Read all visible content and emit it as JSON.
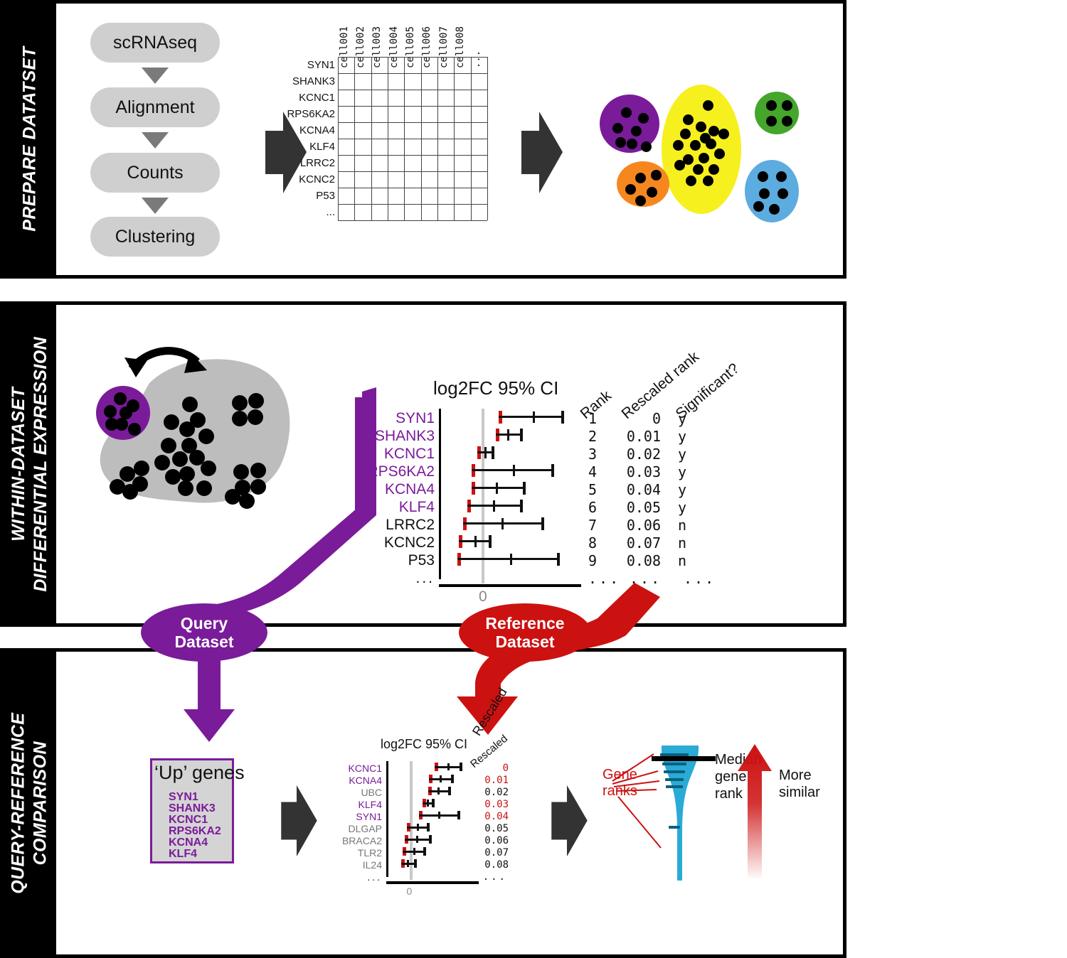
{
  "figure": {
    "title": "scRNAseq query-reference comparison workflow",
    "colors": {
      "purple": "#7a1b9a",
      "red": "#cc1111",
      "yellow": "#f6f01e",
      "green": "#44a62b",
      "orange": "#f6871f",
      "blue": "#5cacdf",
      "cyan": "#29abd6",
      "gray_blob": "#bdbdbd",
      "dark_arrow": "#333333",
      "flow_box": "#cfcfcf"
    }
  },
  "panel1": {
    "side_label_lines": [
      "PREPARE DATATSET"
    ],
    "flow_steps": [
      {
        "label": "scRNAseq"
      },
      {
        "label": "Alignment"
      },
      {
        "label": "Counts"
      },
      {
        "label": "Clustering"
      }
    ],
    "matrix": {
      "row_labels": [
        "SYN1",
        "SHANK3",
        "KCNC1",
        "RPS6KA2",
        "KCNA4",
        "KLF4",
        "LRRC2",
        "KCNC2",
        "P53",
        "..."
      ],
      "col_labels": [
        "cell001",
        "cell002",
        "cell003",
        "cell004",
        "cell005",
        "cell006",
        "cell007",
        "cell008",
        "..."
      ]
    },
    "clusters": [
      {
        "name": "purple-cluster",
        "color": "#7a1b9a",
        "cells": 7
      },
      {
        "name": "yellow-cluster",
        "color": "#f6f01e",
        "cells": 18
      },
      {
        "name": "green-cluster",
        "color": "#44a62b",
        "cells": 4
      },
      {
        "name": "orange-cluster",
        "color": "#f6871f",
        "cells": 5
      },
      {
        "name": "blue-cluster",
        "color": "#5cacdf",
        "cells": 6
      }
    ]
  },
  "panel2": {
    "side_label_lines": [
      "WITHIN-DATASET",
      "DIFFERENTIAL EXPRESSION"
    ],
    "cluster_compare": {
      "query_cluster_color": "#7a1b9a",
      "background_color": "#bdbdbd",
      "arrow": "double-headed-curved-arrow"
    },
    "forest": {
      "plot_title": "log2FC 95% CI",
      "zero_label": "0",
      "headers": [
        "Rank",
        "Rescaled rank",
        "Significant?"
      ],
      "ellipsis": "...",
      "rows": [
        {
          "gene": "SYN1",
          "highlight": true,
          "rank": "1",
          "rescaled": "0",
          "significant": "y",
          "lo": 0.42,
          "mid": 0.66,
          "hi": 0.86
        },
        {
          "gene": "SHANK3",
          "highlight": true,
          "rank": "2",
          "rescaled": "0.01",
          "significant": "y",
          "lo": 0.4,
          "mid": 0.48,
          "hi": 0.57
        },
        {
          "gene": "KCNC1",
          "highlight": true,
          "rank": "3",
          "rescaled": "0.02",
          "significant": "y",
          "lo": 0.27,
          "mid": 0.32,
          "hi": 0.37
        },
        {
          "gene": "RPS6KA2",
          "highlight": true,
          "rank": "4",
          "rescaled": "0.03",
          "significant": "y",
          "lo": 0.23,
          "mid": 0.52,
          "hi": 0.79
        },
        {
          "gene": "KCNA4",
          "highlight": true,
          "rank": "5",
          "rescaled": "0.04",
          "significant": "y",
          "lo": 0.23,
          "mid": 0.4,
          "hi": 0.59
        },
        {
          "gene": "KLF4",
          "highlight": true,
          "rank": "6",
          "rescaled": "0.05",
          "significant": "y",
          "lo": 0.2,
          "mid": 0.38,
          "hi": 0.57
        },
        {
          "gene": "LRRC2",
          "highlight": false,
          "rank": "7",
          "rescaled": "0.06",
          "significant": "n",
          "lo": 0.17,
          "mid": 0.44,
          "hi": 0.72
        },
        {
          "gene": "KCNC2",
          "highlight": false,
          "rank": "8",
          "rescaled": "0.07",
          "significant": "n",
          "lo": 0.14,
          "mid": 0.25,
          "hi": 0.35
        },
        {
          "gene": "P53",
          "highlight": false,
          "rank": "9",
          "rescaled": "0.08",
          "significant": "n",
          "lo": 0.13,
          "mid": 0.5,
          "hi": 0.83
        }
      ]
    }
  },
  "connectors": {
    "query_ellipse": "Query\nDataset",
    "query_line1": "Query",
    "query_line2": "Dataset",
    "reference_line1": "Reference",
    "reference_line2": "Dataset",
    "rescaled_tag": "Rescaled"
  },
  "panel3": {
    "side_label_lines": [
      "QUERY-REFERENCE",
      "COMPARISON"
    ],
    "up_genes_box": {
      "title": "‘Up’ genes",
      "genes": [
        "SYN1",
        "SHANK3",
        "KCNC1",
        "RPS6KA2",
        "KCNA4",
        "KLF4"
      ]
    },
    "forest": {
      "plot_title": "log2FC 95% CI",
      "zero_label": "0",
      "rescaled_header": "Rescaled",
      "ellipsis": "...",
      "rows": [
        {
          "gene": "KCNC1",
          "highlight": true,
          "rescaled": "0",
          "lo": 0.52,
          "mid": 0.66,
          "hi": 0.79
        },
        {
          "gene": "KCNA4",
          "highlight": true,
          "rescaled": "0.01",
          "lo": 0.46,
          "mid": 0.58,
          "hi": 0.7
        },
        {
          "gene": "UBC",
          "highlight": false,
          "rescaled": "0.02",
          "lo": 0.45,
          "mid": 0.55,
          "hi": 0.67
        },
        {
          "gene": "KLF4",
          "highlight": true,
          "rescaled": "0.03",
          "lo": 0.39,
          "mid": 0.44,
          "hi": 0.49
        },
        {
          "gene": "SYN1",
          "highlight": true,
          "rescaled": "0.04",
          "lo": 0.35,
          "mid": 0.56,
          "hi": 0.77
        },
        {
          "gene": "DLGAP",
          "highlight": false,
          "rescaled": "0.05",
          "lo": 0.22,
          "mid": 0.33,
          "hi": 0.44
        },
        {
          "gene": "BRACA2",
          "highlight": false,
          "rescaled": "0.06",
          "lo": 0.2,
          "mid": 0.32,
          "hi": 0.46
        },
        {
          "gene": "TLR2",
          "highlight": false,
          "rescaled": "0.07",
          "lo": 0.18,
          "mid": 0.29,
          "hi": 0.4
        },
        {
          "gene": "IL24",
          "highlight": false,
          "rescaled": "0.08",
          "lo": 0.16,
          "mid": 0.22,
          "hi": 0.3
        }
      ]
    },
    "violin": {
      "gene_ranks_label_l1": "Gene",
      "gene_ranks_label_l2": "ranks",
      "median_label_l1": "Median",
      "median_label_l2": "gene",
      "median_label_l3": "rank",
      "rank_tick_positions": [
        0.06,
        0.13,
        0.19,
        0.25,
        0.31,
        0.62
      ],
      "median_tick_position": 0.09
    },
    "similarity_arrow": {
      "label_l1": "More",
      "label_l2": "similar",
      "direction": "up",
      "color": "#cc1111"
    }
  }
}
